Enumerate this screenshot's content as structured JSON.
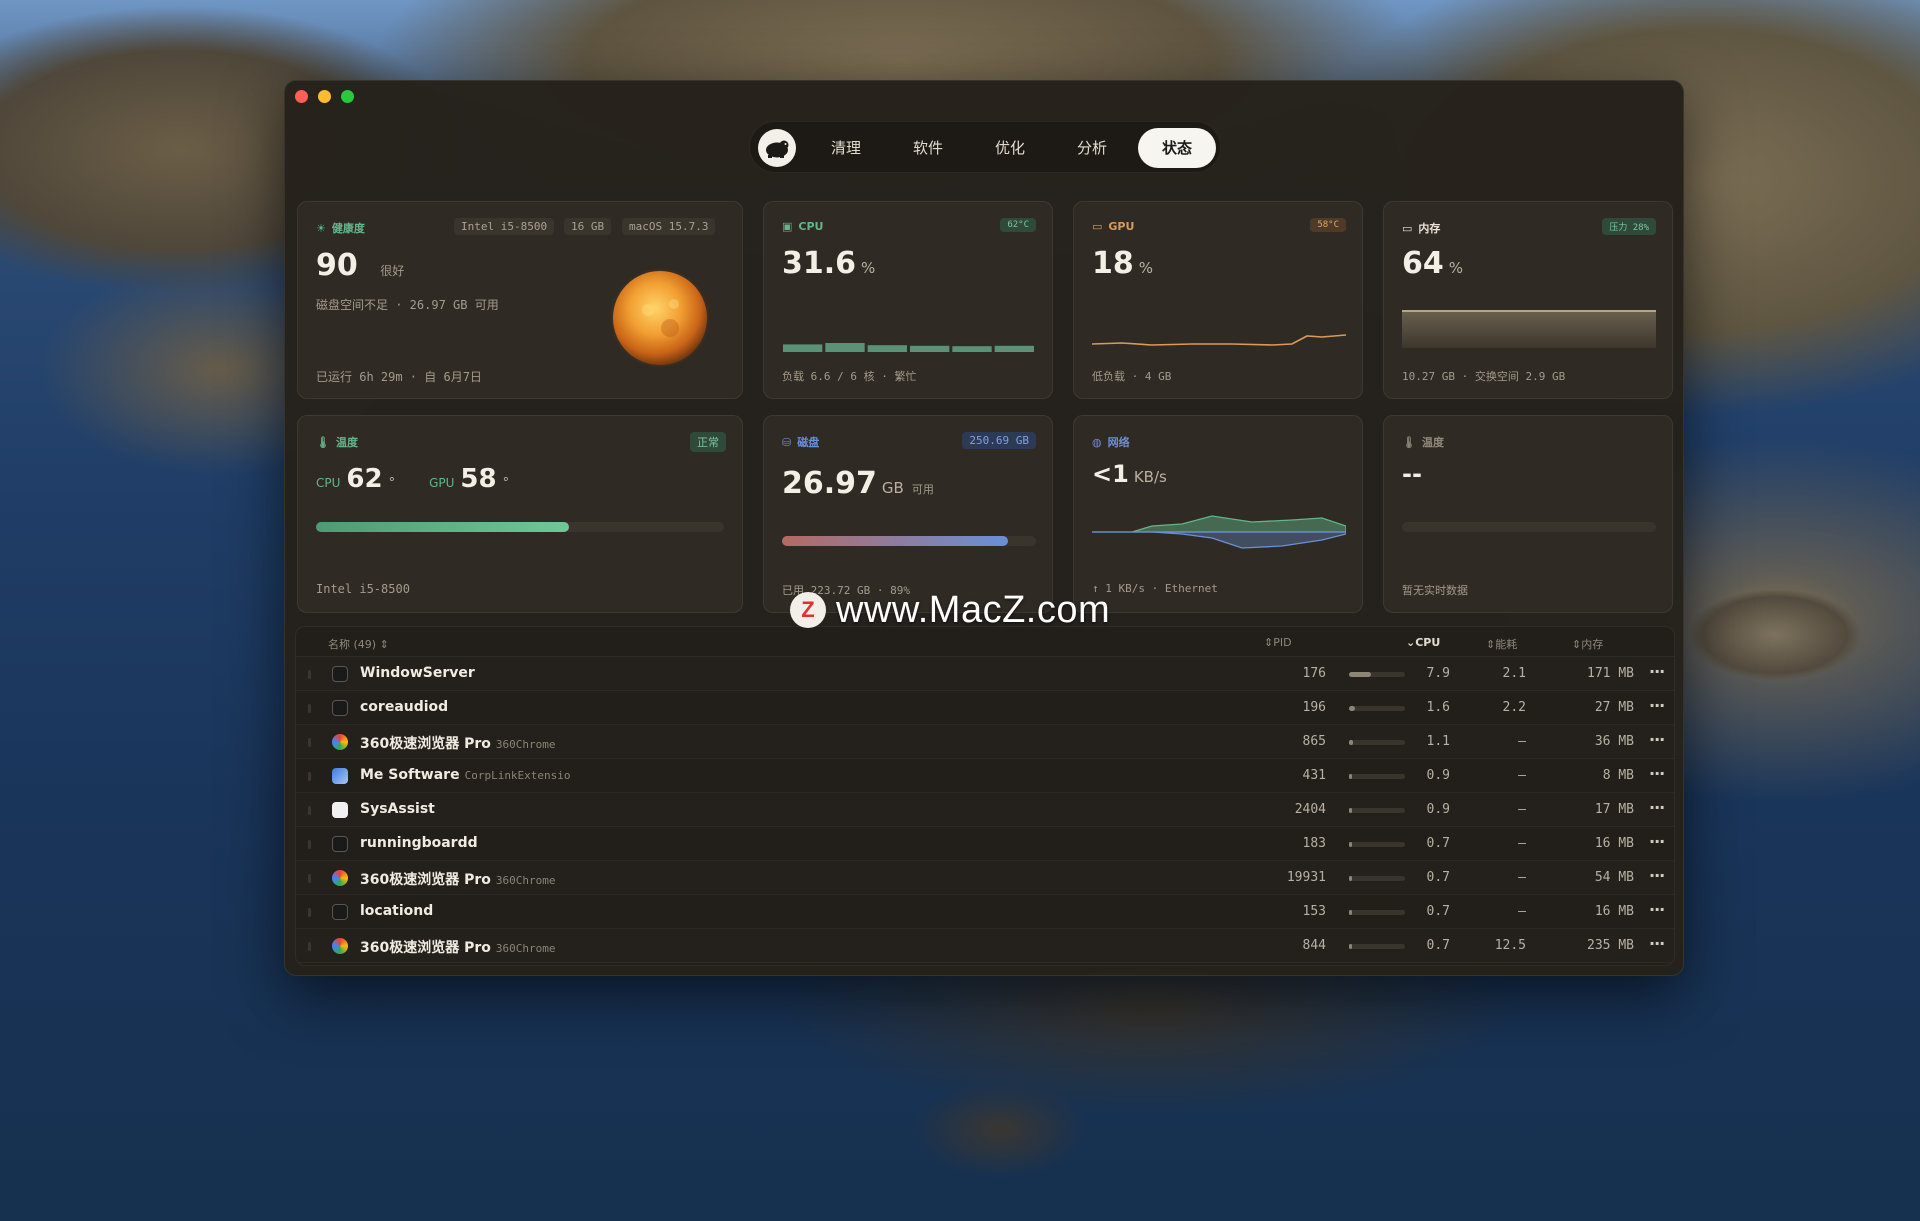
{
  "nav": {
    "tabs": [
      {
        "label": "清理"
      },
      {
        "label": "软件"
      },
      {
        "label": "优化"
      },
      {
        "label": "分析"
      },
      {
        "label": "状态"
      }
    ],
    "active": "状态"
  },
  "health": {
    "title": "健康度",
    "chips": [
      "Intel i5-8500",
      "16 GB",
      "macOS 15.7.3"
    ],
    "score": "90",
    "grade": "很好",
    "note": "磁盘空间不足 · 26.97 GB 可用",
    "uptime": "已运行 6h 29m · 自 6月7日"
  },
  "cpu": {
    "title": "CPU",
    "temp": "62°C",
    "value": "31.6",
    "unit": "%",
    "load": "负载 6.6 / 6 核 · 繁忙",
    "core_loads": [
      0.38,
      0.45,
      0.34,
      0.31,
      0.29,
      0.31
    ],
    "color": "#62a486"
  },
  "gpu": {
    "title": "GPU",
    "temp": "58°C",
    "value": "18",
    "unit": "%",
    "note": "低负载 · 4 GB",
    "color": "#d99a5b"
  },
  "memory": {
    "title": "内存",
    "pressure": "压力 28%",
    "value": "64",
    "unit": "%",
    "note": "10.27 GB · 交换空间 2.9 GB",
    "level": 0.64
  },
  "temperature": {
    "title": "温度",
    "status": "正常",
    "cpu_label": "CPU",
    "cpu_value": "62",
    "gpu_label": "GPU",
    "gpu_value": "58",
    "deg": "°",
    "level": 0.62,
    "cpu_model": "Intel i5-8500"
  },
  "disk": {
    "title": "磁盘",
    "total": "250.69 GB",
    "value": "26.97",
    "unit": "GB",
    "unit_sub": "可用",
    "note": "已用 223.72 GB · 89%",
    "level": 0.89
  },
  "network": {
    "title": "网络",
    "value": "<1",
    "unit": "KB/s",
    "note": "↑ 1 KB/s · Ethernet"
  },
  "temp2": {
    "title": "温度",
    "value": "--",
    "note": "暂无实时数据"
  },
  "process_table": {
    "header": {
      "name": "名称 (49)",
      "pid": "PID",
      "cpu": "CPU",
      "energy": "能耗",
      "memory": "内存"
    },
    "rows": [
      {
        "name": "WindowServer",
        "sub": "",
        "pid": "176",
        "cpu": "7.9",
        "cpu_frac": 0.08,
        "energy": "2.1",
        "mem": "171 MB",
        "icon": "activity-icon"
      },
      {
        "name": "coreaudiod",
        "sub": "",
        "pid": "196",
        "cpu": "1.6",
        "cpu_frac": 0.02,
        "energy": "2.2",
        "mem": "27 MB",
        "icon": "activity-icon"
      },
      {
        "name": "360极速浏览器 Pro",
        "sub": "360Chrome",
        "pid": "865",
        "cpu": "1.1",
        "cpu_frac": 0.015,
        "energy": "—",
        "mem": "36 MB",
        "icon": "browser-icon"
      },
      {
        "name": "Me Software",
        "sub": "CorpLinkExtensio",
        "pid": "431",
        "cpu": "0.9",
        "cpu_frac": 0.01,
        "energy": "—",
        "mem": "8 MB",
        "icon": "app-icon"
      },
      {
        "name": "SysAssist",
        "sub": "",
        "pid": "2404",
        "cpu": "0.9",
        "cpu_frac": 0.01,
        "energy": "—",
        "mem": "17 MB",
        "icon": "blank-app-icon"
      },
      {
        "name": "runningboardd",
        "sub": "",
        "pid": "183",
        "cpu": "0.7",
        "cpu_frac": 0.008,
        "energy": "—",
        "mem": "16 MB",
        "icon": "activity-icon"
      },
      {
        "name": "360极速浏览器 Pro",
        "sub": "360Chrome",
        "pid": "19931",
        "cpu": "0.7",
        "cpu_frac": 0.008,
        "energy": "—",
        "mem": "54 MB",
        "icon": "browser-icon"
      },
      {
        "name": "locationd",
        "sub": "",
        "pid": "153",
        "cpu": "0.7",
        "cpu_frac": 0.008,
        "energy": "—",
        "mem": "16 MB",
        "icon": "activity-icon"
      },
      {
        "name": "360极速浏览器 Pro",
        "sub": "360Chrome",
        "pid": "844",
        "cpu": "0.7",
        "cpu_frac": 0.008,
        "energy": "12.5",
        "mem": "235 MB",
        "icon": "browser-icon"
      }
    ],
    "more_label": "···"
  },
  "watermark": {
    "badge": "Z",
    "text": "www.MacZ.com"
  },
  "colors": {
    "green": "#62b58a",
    "gpu_orange": "#d99a5b",
    "blue": "#6a8fd6",
    "accent_mem": "#c9b58e"
  }
}
